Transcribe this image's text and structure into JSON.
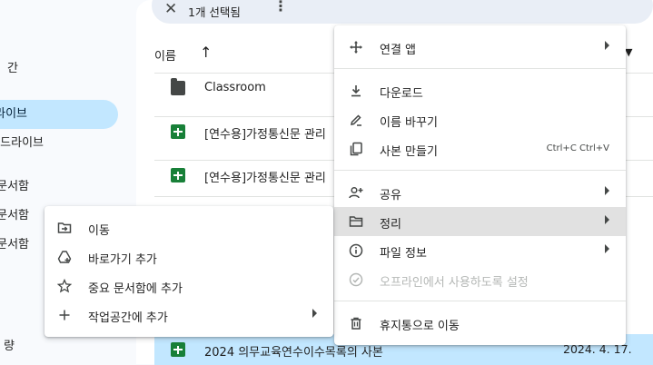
{
  "sidebar": {
    "items": [
      {
        "label": "간",
        "active": false
      },
      {
        "label": "라이브",
        "active": true
      },
      {
        "label": "드라이브",
        "active": false
      },
      {
        "label": "문서함",
        "active": false
      },
      {
        "label": "문서함",
        "active": false
      },
      {
        "label": "문서함",
        "active": false
      },
      {
        "label": "량",
        "active": false
      }
    ]
  },
  "selection_bar": {
    "close_icon": "close-icon",
    "count_label": "1개 선택됨",
    "more_icon": "more-vert-icon"
  },
  "list": {
    "name_header": "이름",
    "sort_icon": "arrow-up-icon",
    "rows": [
      {
        "name": "Classroom",
        "type": "folder",
        "date": ""
      },
      {
        "name": "[연수용]가정통신문 관리",
        "type": "sheet",
        "date": ""
      },
      {
        "name": "[연수용]가정통신문 관리",
        "type": "sheet",
        "date": ""
      },
      {
        "name": "2024 의무교육연수이수목록의 사본",
        "type": "sheet",
        "date": "2024. 4. 17."
      }
    ]
  },
  "context_menu": {
    "items": [
      {
        "label": "연결 앱",
        "icon": "apps-move-icon",
        "submenu": true
      },
      {
        "label": "다운로드",
        "icon": "download-icon"
      },
      {
        "label": "이름 바꾸기",
        "icon": "rename-pen-icon"
      },
      {
        "label": "사본 만들기",
        "icon": "copy-icon",
        "shortcut": "Ctrl+C Ctrl+V"
      },
      {
        "label": "공유",
        "icon": "share-person-add-icon",
        "submenu": true
      },
      {
        "label": "정리",
        "icon": "folder-open-icon",
        "submenu": true,
        "highlighted": true
      },
      {
        "label": "파일 정보",
        "icon": "info-icon",
        "submenu": true
      },
      {
        "label": "오프라인에서 사용하도록 설정",
        "icon": "offline-icon",
        "disabled": true
      },
      {
        "label": "휴지통으로 이동",
        "icon": "trash-icon"
      }
    ]
  },
  "organize_submenu": {
    "items": [
      {
        "label": "이동",
        "icon": "move-folder-icon"
      },
      {
        "label": "바로가기 추가",
        "icon": "add-shortcut-icon"
      },
      {
        "label": "중요 문서함에 추가",
        "icon": "star-icon"
      },
      {
        "label": "작업공간에 추가",
        "icon": "plus-icon",
        "submenu": true
      }
    ]
  },
  "colors": {
    "accent": "#c2e7ff",
    "sheets_green": "#188038",
    "highlight": "#e1e1e1"
  }
}
